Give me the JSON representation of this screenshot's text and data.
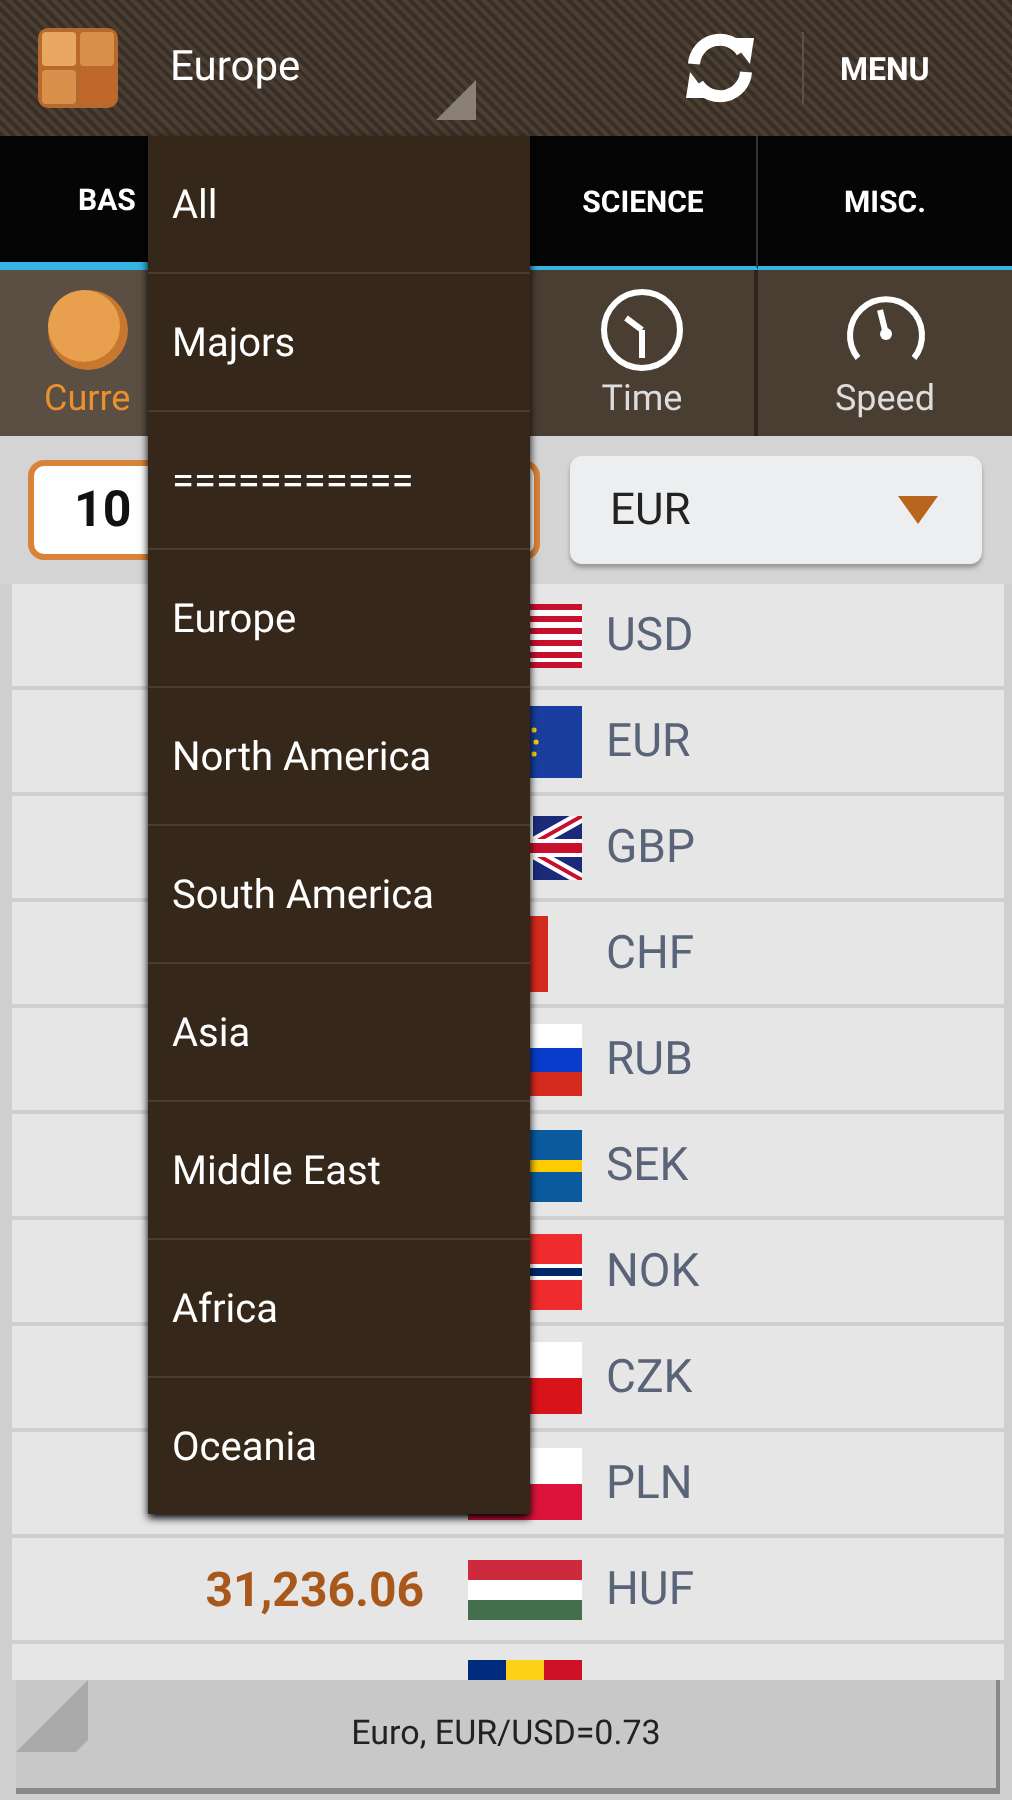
{
  "header": {
    "title": "Europe",
    "menu": "MENU"
  },
  "tabs": [
    {
      "label": "BAS",
      "selected": true
    },
    {
      "label": "SCIENCE",
      "selected": false
    },
    {
      "label": "MISC.",
      "selected": false
    }
  ],
  "categories": [
    {
      "label": "Curre",
      "selected": true
    },
    {
      "label": "Time",
      "selected": false
    },
    {
      "label": "Speed",
      "selected": false
    }
  ],
  "amount_field": {
    "value": "10"
  },
  "currency_select": {
    "value": "EUR"
  },
  "rows": [
    {
      "code": "USD"
    },
    {
      "code": "EUR"
    },
    {
      "code": "GBP"
    },
    {
      "code": "CHF"
    },
    {
      "code": "RUB"
    },
    {
      "code": "SEK"
    },
    {
      "code": "NOK"
    },
    {
      "code": "CZK"
    },
    {
      "code": "PLN"
    },
    {
      "code": "HUF",
      "amount": "31,236.06"
    },
    {}
  ],
  "status_bar": "Euro, EUR/USD=0.73",
  "dropdown": [
    "All",
    "Majors",
    "===========",
    "Europe",
    "North America",
    "South America",
    "Asia",
    "Middle East",
    "Africa",
    "Oceania"
  ]
}
